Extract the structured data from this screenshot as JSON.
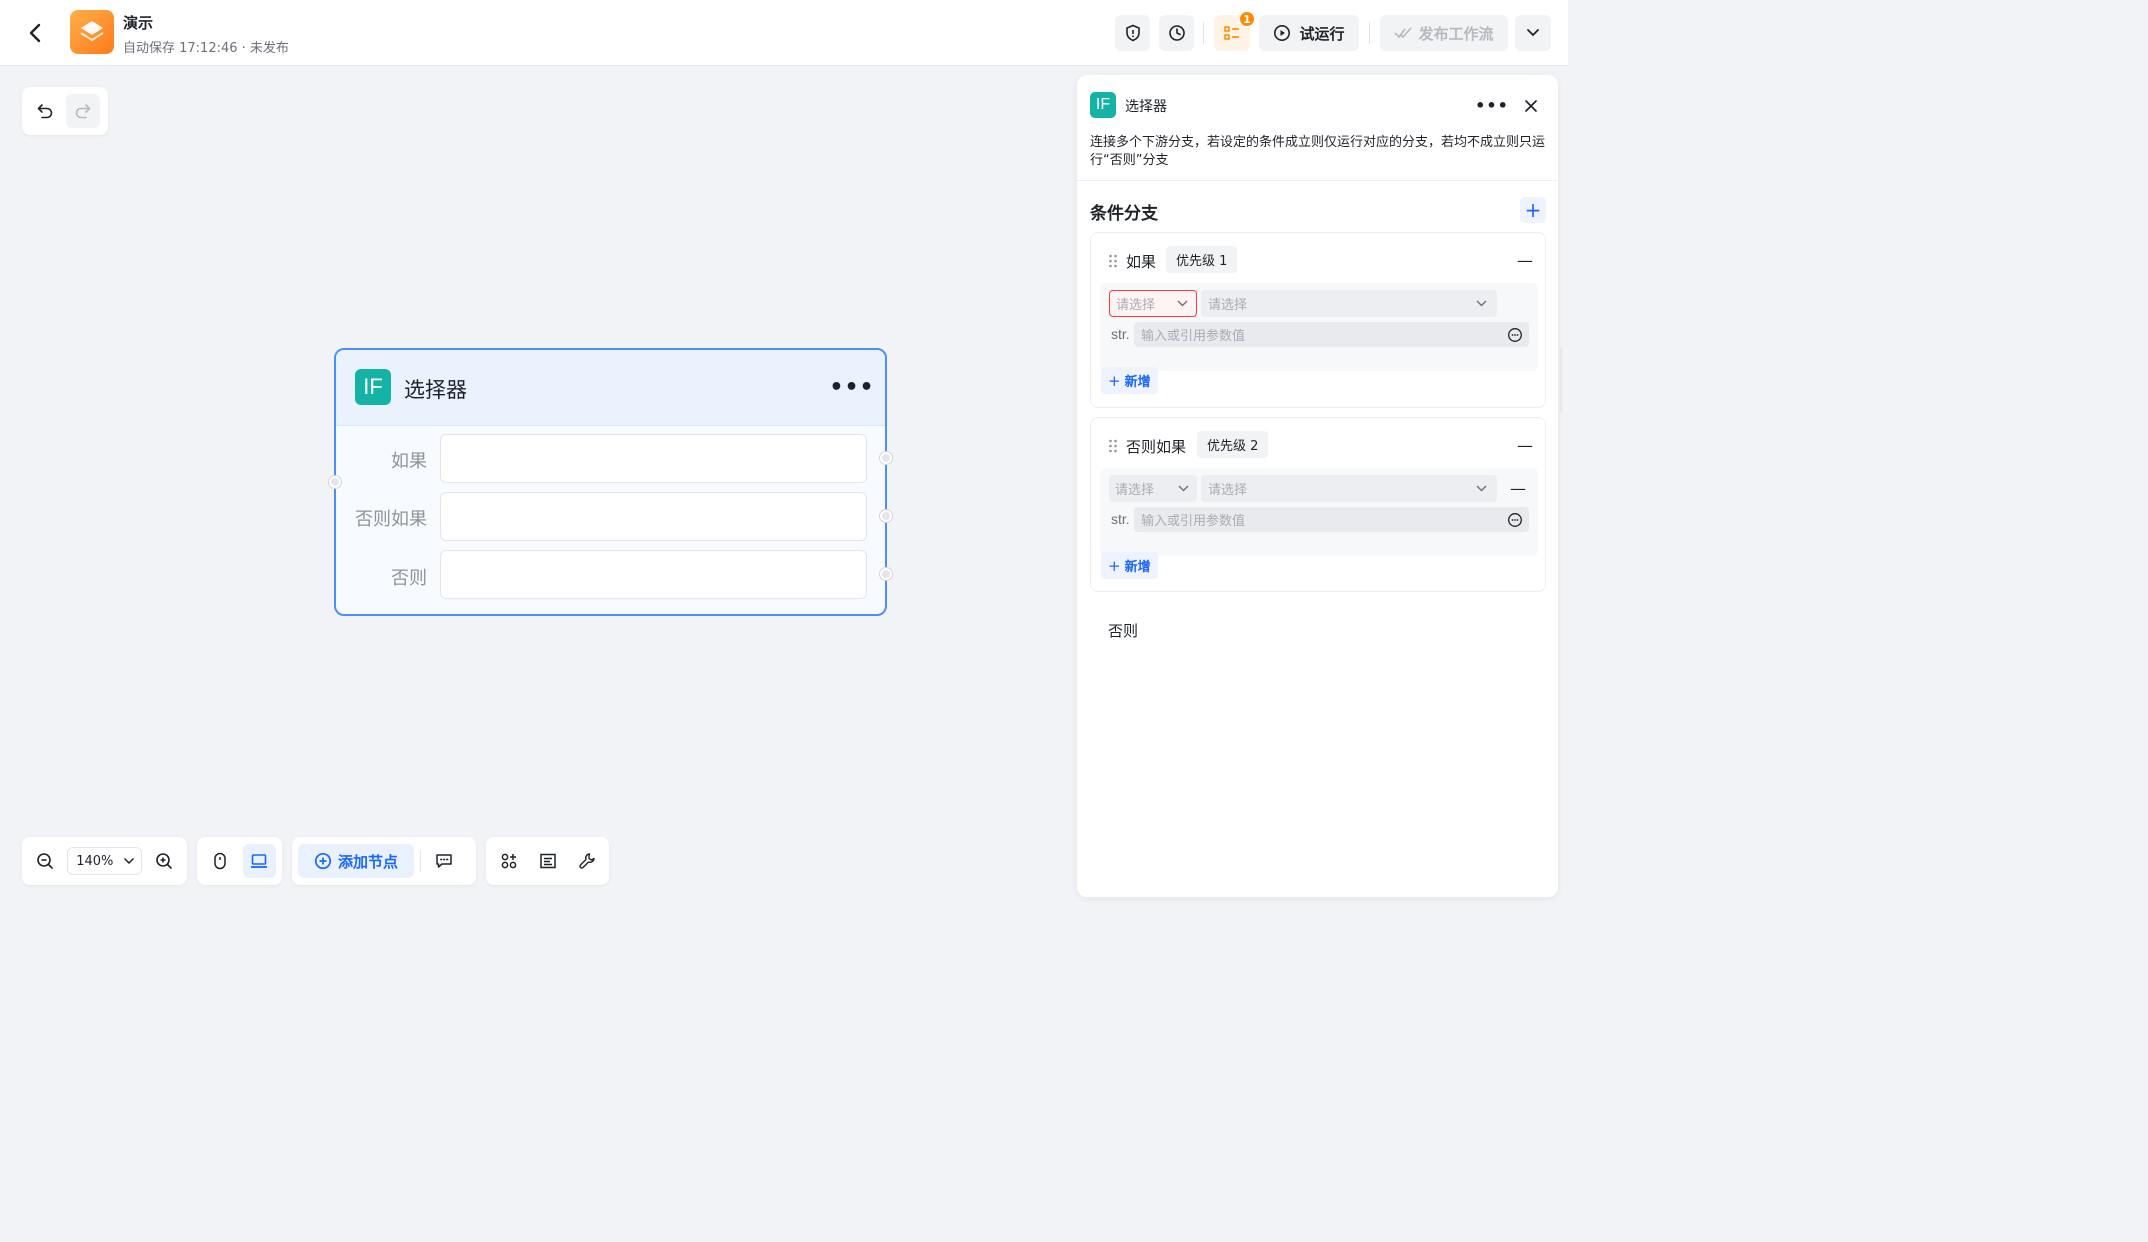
{
  "header": {
    "title": "演示",
    "subtitle": "自动保存 17:12:46 · 未发布",
    "notification_count": "1",
    "run_label": "试运行",
    "publish_label": "发布工作流"
  },
  "canvas": {
    "node": {
      "icon_text": "IF",
      "title": "选择器",
      "rows": [
        {
          "label": "如果"
        },
        {
          "label": "否则如果"
        },
        {
          "label": "否则"
        }
      ]
    }
  },
  "toolbar": {
    "zoom": "140%",
    "add_node_label": "添加节点"
  },
  "panel": {
    "icon_text": "IF",
    "title": "选择器",
    "description": "连接多个下游分支，若设定的条件成立则仅运行对应的分支，若均不成立则只运行“否则”分支",
    "section_title": "条件分支",
    "branches": [
      {
        "title": "如果",
        "priority": "优先级 1",
        "left_select": "请选择",
        "op_select": "请选择",
        "type_label": "str.",
        "value_placeholder": "输入或引用参数值",
        "add_label": "新增"
      },
      {
        "title": "否则如果",
        "priority": "优先级 2",
        "left_select": "请选择",
        "op_select": "请选择",
        "type_label": "str.",
        "value_placeholder": "输入或引用参数值",
        "add_label": "新增"
      }
    ],
    "else_label": "否则"
  },
  "colors": {
    "accent": "#1a66ff",
    "node_border": "#4d8ef7",
    "if_icon": "#14b3a5",
    "app_icon": "#ff8a00",
    "error": "#f53f3f"
  },
  "icons": [
    "back-icon",
    "app-logo-icon",
    "shield-icon",
    "history-icon",
    "log-icon",
    "play-icon",
    "check-icon",
    "chevron-down-icon",
    "undo-icon",
    "redo-icon",
    "zoom-out-icon",
    "zoom-in-icon",
    "mouse-icon",
    "trackpad-icon",
    "plus-circle-icon",
    "comment-icon",
    "layout-icon",
    "note-icon",
    "wrench-icon",
    "close-icon",
    "drag-handle-icon",
    "variable-icon"
  ]
}
